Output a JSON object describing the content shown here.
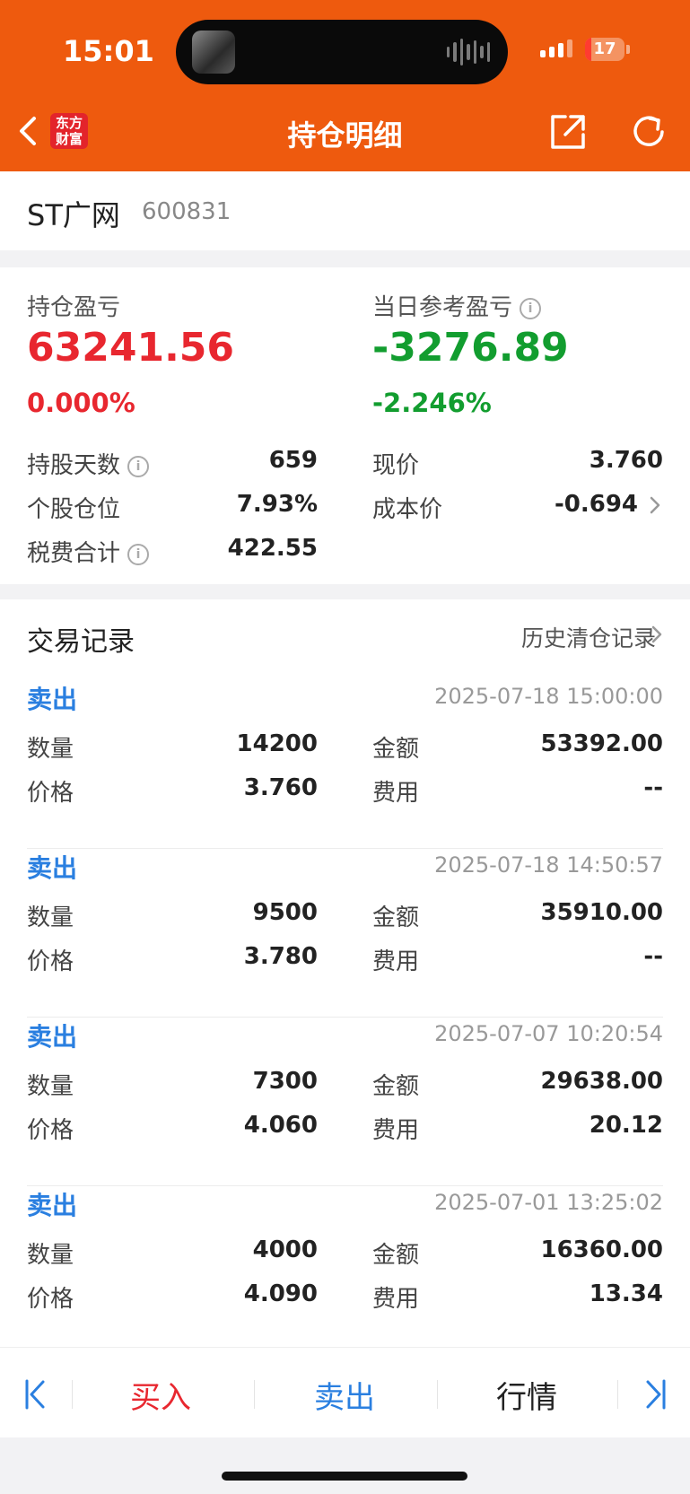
{
  "status_bar": {
    "time": "15:01",
    "battery": "17",
    "battery_level": 0.17
  },
  "nav": {
    "title": "持仓明细",
    "logo_line1": "东方",
    "logo_line2": "财富"
  },
  "stock": {
    "name": "ST广网",
    "code": "600831"
  },
  "summary": {
    "position_pl_label": "持仓盈亏",
    "position_pl_value": "63241.56",
    "position_pl_pct": "0.000%",
    "daily_pl_label": "当日参考盈亏",
    "daily_pl_value": "-3276.89",
    "daily_pl_pct": "-2.246%",
    "hold_days_label": "持股天数",
    "hold_days_value": "659",
    "current_price_label": "现价",
    "current_price_value": "3.760",
    "position_ratio_label": "个股仓位",
    "position_ratio_value": "7.93%",
    "cost_price_label": "成本价",
    "cost_price_value": "-0.694",
    "fees_total_label": "税费合计",
    "fees_total_value": "422.55"
  },
  "trades_section": {
    "title": "交易记录",
    "history_link": "历史清仓记录"
  },
  "trade_labels": {
    "quantity": "数量",
    "amount": "金额",
    "price": "价格",
    "fee": "费用"
  },
  "trades": [
    {
      "type": "卖出",
      "time": "2025-07-18 15:00:00",
      "quantity": "14200",
      "amount": "53392.00",
      "price": "3.760",
      "fee": "--"
    },
    {
      "type": "卖出",
      "time": "2025-07-18 14:50:57",
      "quantity": "9500",
      "amount": "35910.00",
      "price": "3.780",
      "fee": "--"
    },
    {
      "type": "卖出",
      "time": "2025-07-07 10:20:54",
      "quantity": "7300",
      "amount": "29638.00",
      "price": "4.060",
      "fee": "20.12"
    },
    {
      "type": "卖出",
      "time": "2025-07-01 13:25:02",
      "quantity": "4000",
      "amount": "16360.00",
      "price": "4.090",
      "fee": "13.34"
    }
  ],
  "toolbar": {
    "buy": "买入",
    "sell": "卖出",
    "market": "行情"
  },
  "colors": {
    "brand": "#ee5a0e",
    "profit": "#e8272f",
    "loss": "#129d2f",
    "sell": "#2a7fe0"
  },
  "icons": [
    "back-chevron-icon",
    "share-icon",
    "refresh-icon",
    "info-icon",
    "chevron-right-icon",
    "first-page-icon",
    "last-page-icon"
  ]
}
